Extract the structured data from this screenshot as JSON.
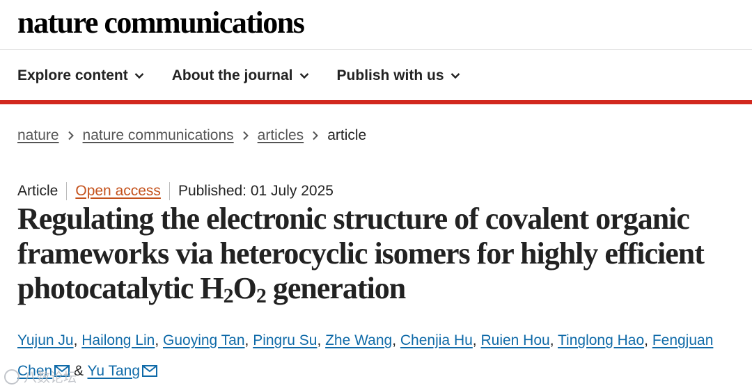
{
  "site": {
    "logo": "nature communications"
  },
  "nav": {
    "items": [
      {
        "label": "Explore content"
      },
      {
        "label": "About the journal"
      },
      {
        "label": "Publish with us"
      }
    ]
  },
  "breadcrumb": {
    "items": [
      "nature",
      "nature communications",
      "articles"
    ],
    "current": "article"
  },
  "article": {
    "type": "Article",
    "access": "Open access",
    "published": "Published: 01 July 2025",
    "title_part1": "Regulating the electronic structure of covalent organic frameworks via heterocyclic isomers for highly efficient photocatalytic H",
    "title_sub1": "2",
    "title_part2": "O",
    "title_sub2": "2",
    "title_part3": " generation",
    "authors": [
      "Yujun Ju",
      "Hailong Lin",
      "Guoying Tan",
      "Pingru Su",
      "Zhe Wang",
      "Chenjia Hu",
      "Ruien Hou",
      "Tinglong Hao",
      "Fengjuan Chen",
      "Yu Tang"
    ],
    "author_sep": ", ",
    "author_and": " & "
  },
  "watermark": {
    "text": "八数论坛"
  },
  "colors": {
    "accent_red": "#d2281e",
    "link_blue": "#0f6aa8",
    "open_access": "#c4511b"
  }
}
